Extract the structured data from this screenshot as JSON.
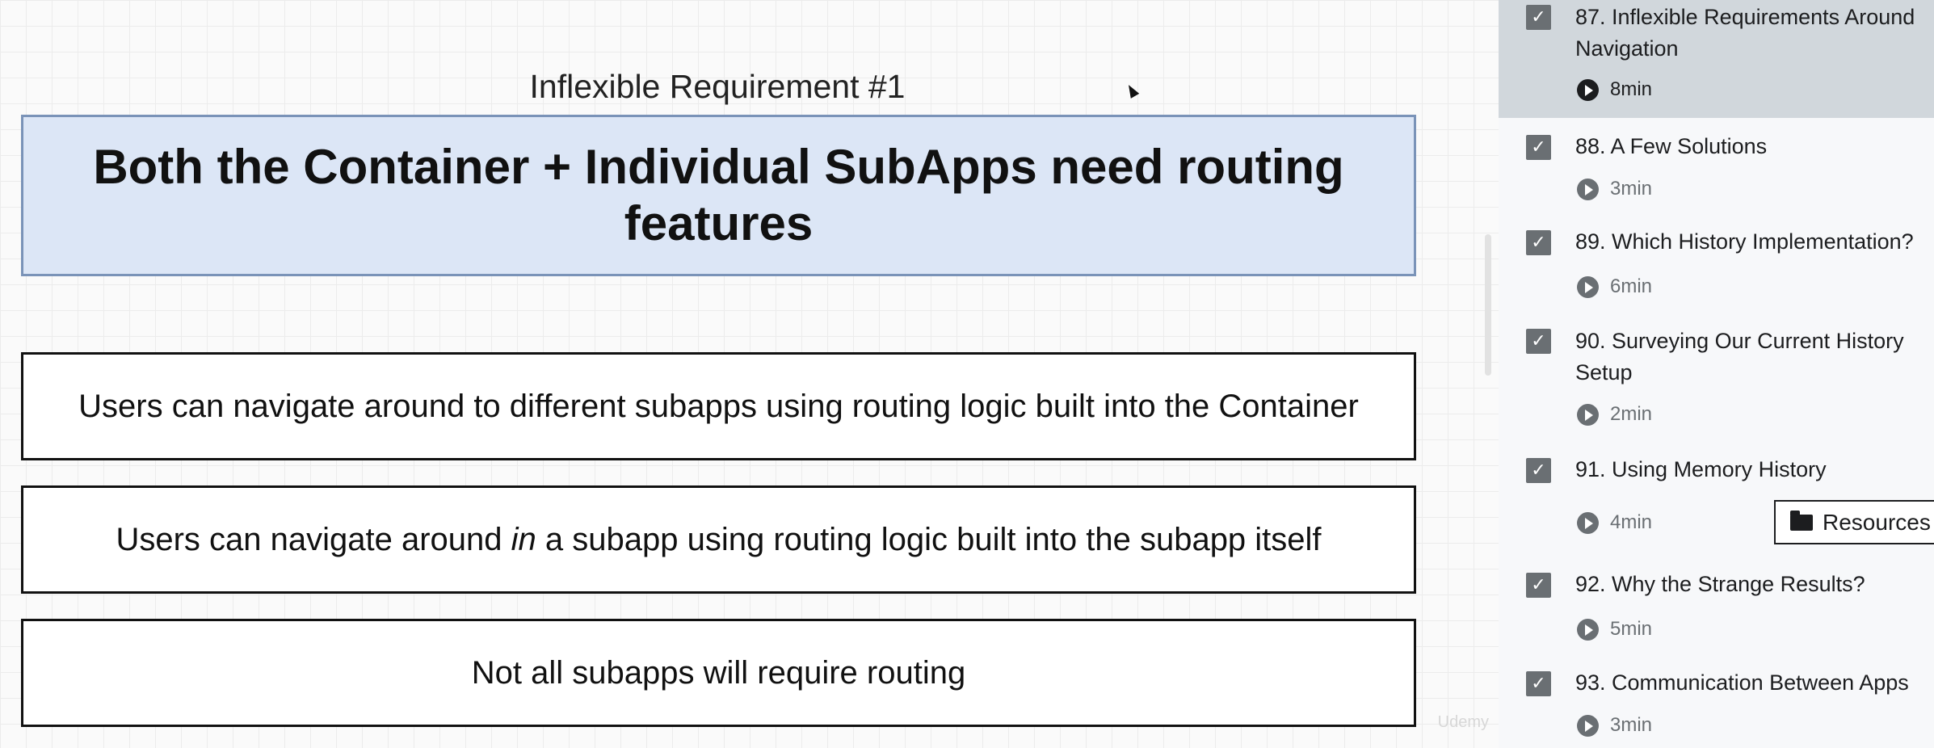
{
  "slide": {
    "title": "Inflexible Requirement #1",
    "headline": "Both the Container + Individual SubApps need routing features",
    "points": [
      {
        "text": "Users can navigate around to different subapps using routing logic built into the Container"
      },
      {
        "before": "Users can navigate around ",
        "emphasis": "in",
        "after": " a subapp using routing logic built into the subapp itself"
      },
      {
        "text": "Not all subapps will require routing"
      }
    ],
    "watermark": "Udemy"
  },
  "sidebar": {
    "lectures": [
      {
        "title": "87. Inflexible Requirements Around Navigation",
        "duration": "8min",
        "completed": true,
        "active": true
      },
      {
        "title": "88. A Few Solutions",
        "duration": "3min",
        "completed": true,
        "active": false
      },
      {
        "title": "89. Which History Implementation?",
        "duration": "6min",
        "completed": true,
        "active": false
      },
      {
        "title": "90. Surveying Our Current History Setup",
        "duration": "2min",
        "completed": true,
        "active": false
      },
      {
        "title": "91. Using Memory History",
        "duration": "4min",
        "completed": true,
        "active": false
      },
      {
        "title": "92. Why the Strange Results?",
        "duration": "5min",
        "completed": true,
        "active": false
      },
      {
        "title": "93. Communication Between Apps",
        "duration": "3min",
        "completed": true,
        "active": false
      }
    ],
    "resources_label": "Resources",
    "check_glyph": "✓"
  },
  "colors": {
    "active_row": "#d1d7dc",
    "headline_fill": "#dce6f6",
    "headline_border": "#7a93b8",
    "checkbox": "#6a6f73"
  }
}
